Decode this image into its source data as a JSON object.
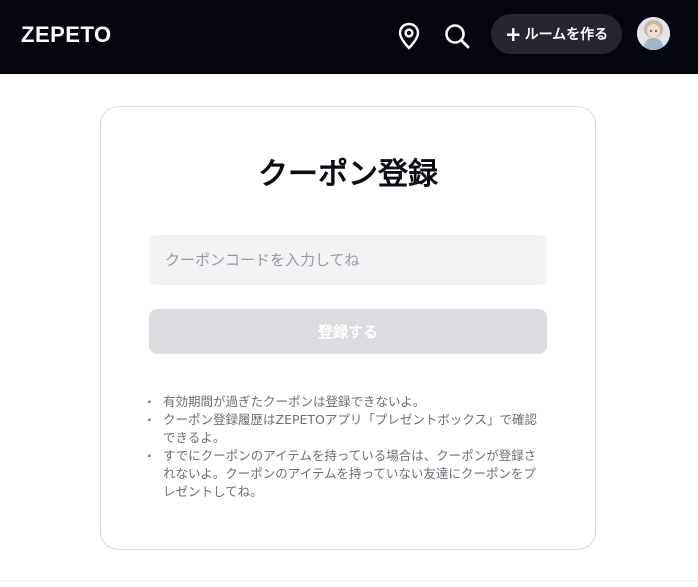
{
  "header": {
    "logo": "ZEPETO",
    "location_icon": "map-pin-icon",
    "search_icon": "search-icon",
    "create_room_label": "ルームを作る",
    "create_room_icon": "plus-icon",
    "background_color": "#05050f"
  },
  "coupon": {
    "title": "クーポン登録",
    "input_placeholder": "クーポンコードを入力してね",
    "input_value": "",
    "register_label": "登録する",
    "notes": [
      "有効期間が過ぎたクーポンは登録できないよ。",
      "クーポン登録履歴はZEPETOアプリ「プレゼントボックス」で確認できるよ。",
      "すでにクーポンのアイテムを持っている場合は、クーポンが登録されないよ。クーポンのアイテムを持っていない友達にクーポンをプレゼントしてね。"
    ]
  }
}
